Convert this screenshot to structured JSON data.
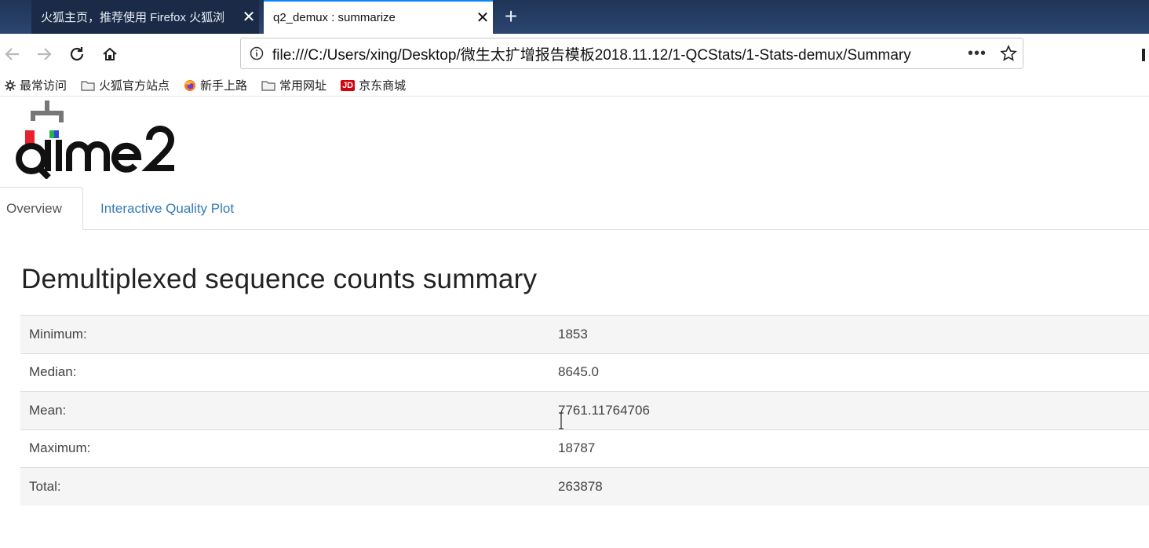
{
  "browser": {
    "tabs": [
      {
        "title": "火狐主页，推荐使用 Firefox 火狐浏",
        "active": false
      },
      {
        "title": "q2_demux : summarize",
        "active": true
      }
    ],
    "new_tab_icon": "plus-icon",
    "url": "file:///C:/Users/xing/Desktop/微生太扩增报告模板2018.11.12/1-QCStats/1-Stats-demux/Summary",
    "more_label": "•••",
    "bookmarks": [
      {
        "label": "最常访问",
        "icon": "gear-icon"
      },
      {
        "label": "火狐官方站点",
        "icon": "folder-icon"
      },
      {
        "label": "新手上路",
        "icon": "firefox-icon"
      },
      {
        "label": "常用网址",
        "icon": "folder-icon"
      },
      {
        "label": "京东商城",
        "icon": "jd-icon",
        "icon_text": "JD"
      }
    ]
  },
  "page": {
    "logo_text": "qiime2",
    "tabs": [
      {
        "label": "Overview",
        "active": true
      },
      {
        "label": "Interactive Quality Plot",
        "active": false
      }
    ],
    "title": "Demultiplexed sequence counts summary",
    "stats": [
      {
        "label": "Minimum:",
        "value": "1853"
      },
      {
        "label": "Median:",
        "value": "8645.0"
      },
      {
        "label": "Mean:",
        "value": "7761.11764706"
      },
      {
        "label": "Maximum:",
        "value": "18787"
      },
      {
        "label": "Total:",
        "value": "263878"
      }
    ]
  },
  "colors": {
    "tab_strip": "#1f3457",
    "link": "#337ab7",
    "row_alt": "#f5f5f5",
    "active_tab_accent": "#0a84ff"
  }
}
